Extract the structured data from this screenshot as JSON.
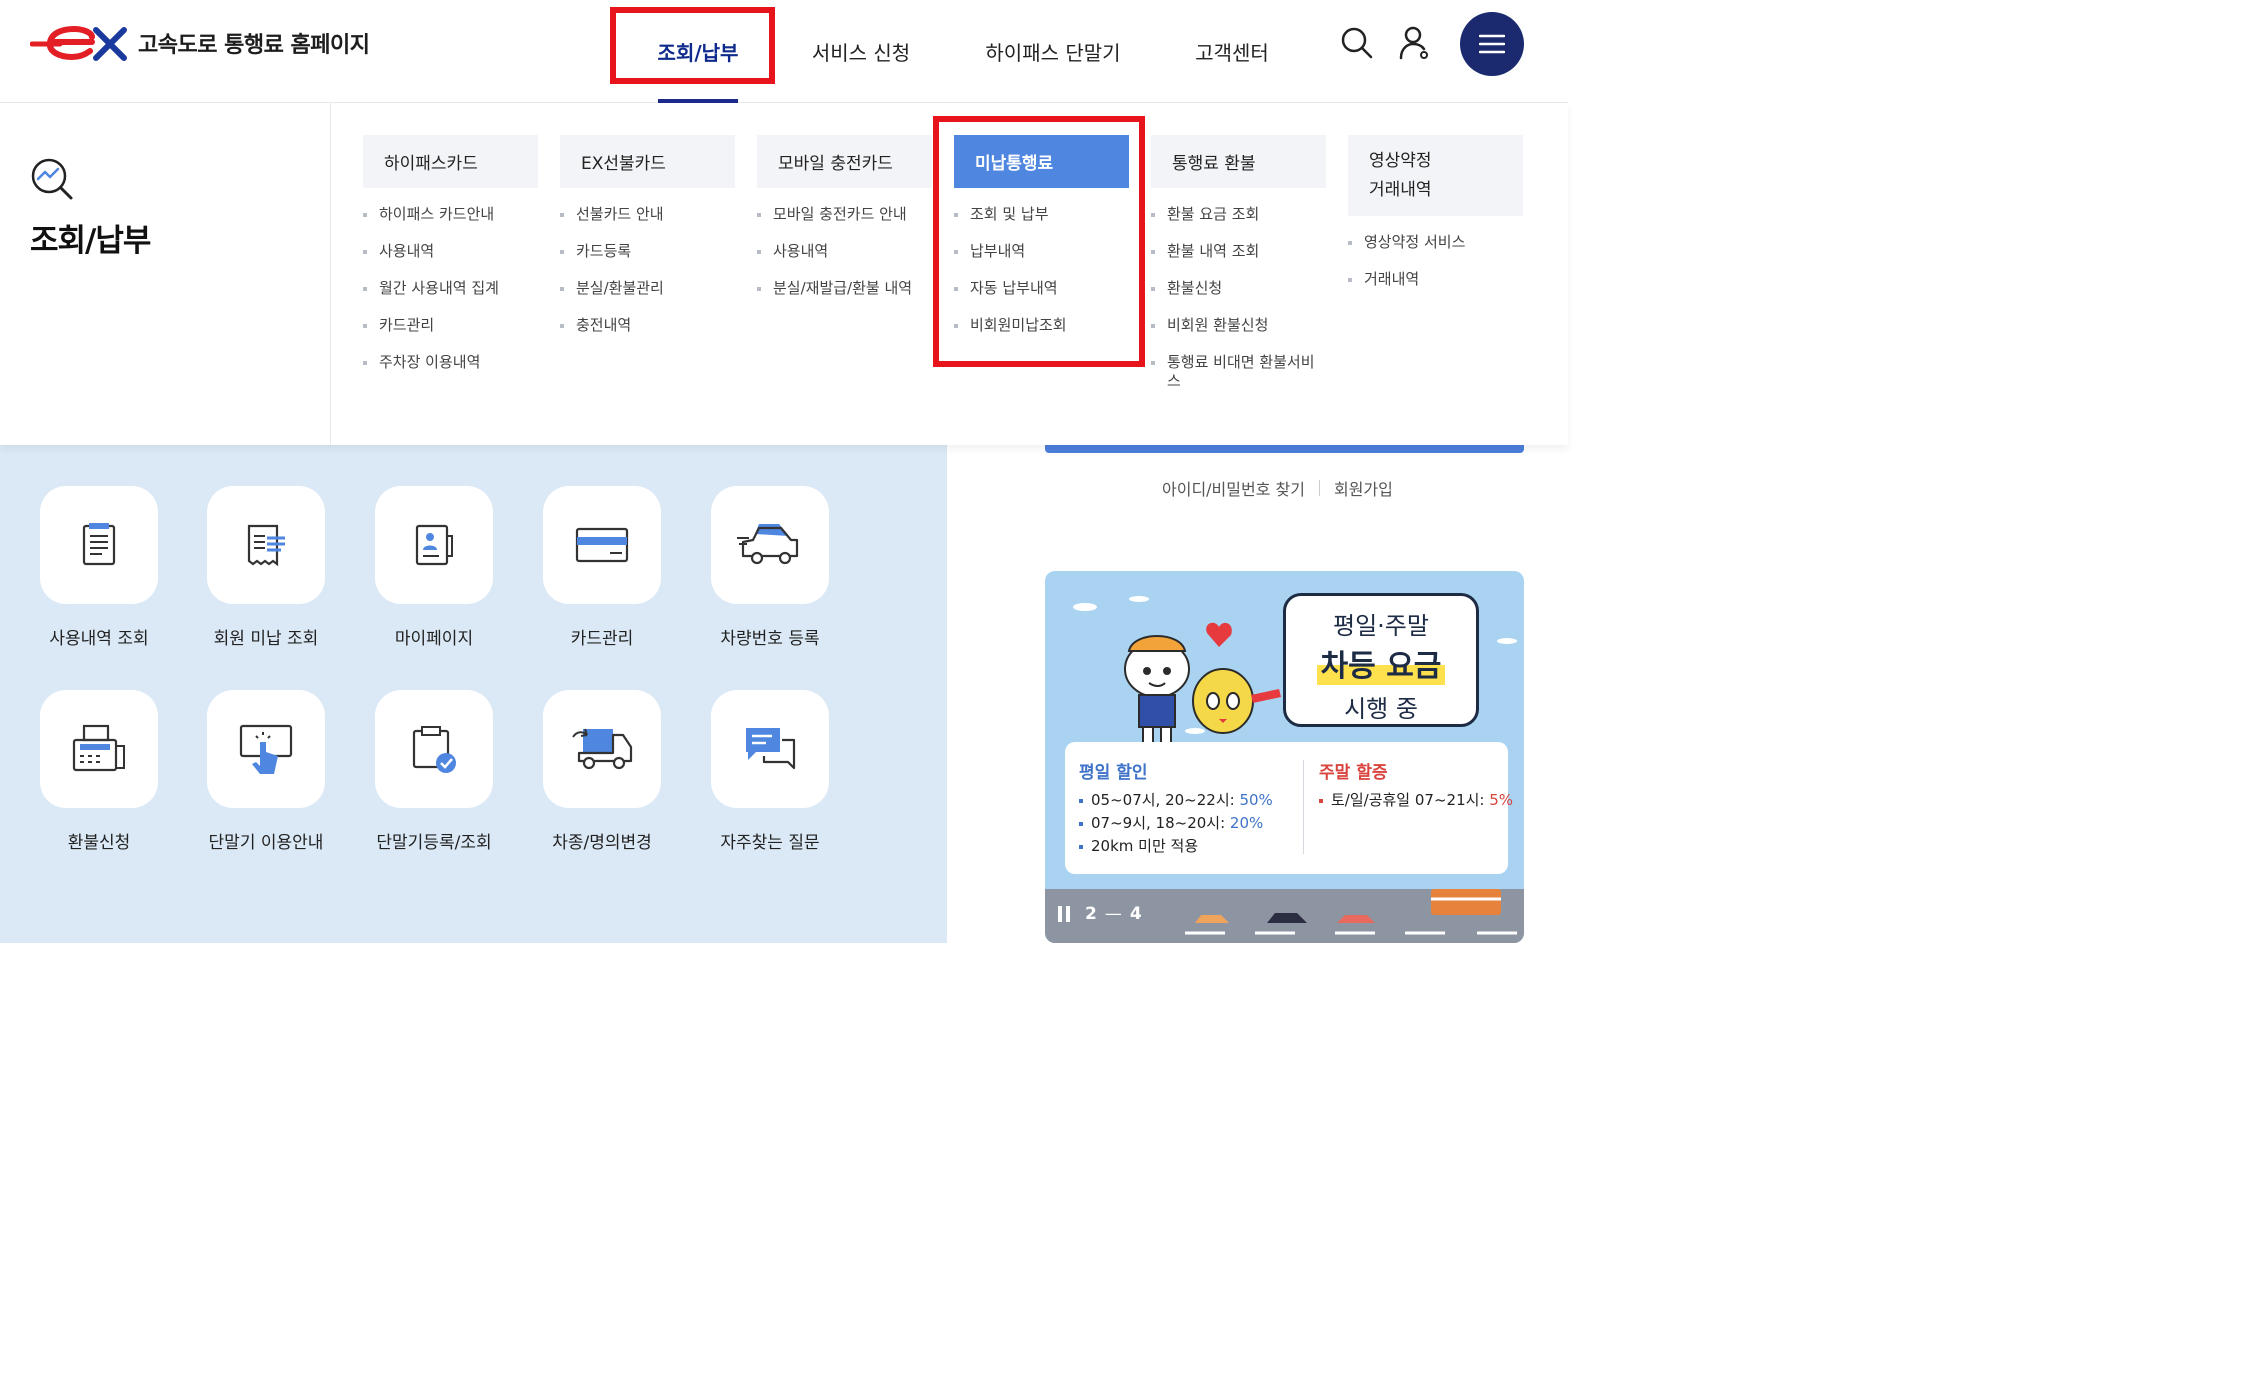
{
  "header": {
    "site_title": "고속도로 통행료 홈페이지",
    "nav": [
      "조회/납부",
      "서비스 신청",
      "하이패스 단말기",
      "고객센터"
    ]
  },
  "mega": {
    "title": "조회/납부",
    "columns": [
      {
        "head": "하이패스카드",
        "items": [
          "하이패스 카드안내",
          "사용내역",
          "월간 사용내역 집계",
          "카드관리",
          "주차장 이용내역"
        ]
      },
      {
        "head": "EX선불카드",
        "items": [
          "선불카드 안내",
          "카드등록",
          "분실/환불관리",
          "충전내역"
        ]
      },
      {
        "head": "모바일 충전카드",
        "items": [
          "모바일 충전카드 안내",
          "사용내역",
          "분실/재발급/환불 내역"
        ]
      },
      {
        "head": "미납통행료",
        "items": [
          "조회 및 납부",
          "납부내역",
          "자동 납부내역",
          "비회원미납조회"
        ]
      },
      {
        "head": "통행료 환불",
        "items": [
          "환불 요금 조회",
          "환불 내역 조회",
          "환불신청",
          "비회원 환불신청",
          "통행료 비대면 환불서비스"
        ]
      },
      {
        "head_line1": "영상약정",
        "head_line2": "거래내역",
        "items": [
          "영상약정 서비스",
          "거래내역"
        ]
      }
    ]
  },
  "quick_menu": [
    "사용내역 조회",
    "회원 미납 조회",
    "마이페이지",
    "카드관리",
    "차량번호 등록",
    "환불신청",
    "단말기 이용안내",
    "단말기등록/조회",
    "차종/명의변경",
    "자주찾는 질문"
  ],
  "login": {
    "find_label": "아이디/비밀번호 찾기",
    "join_label": "회원가입"
  },
  "banner": {
    "bubble_line1": "평일·주말",
    "bubble_line2": "차등 요금",
    "bubble_line3": "시행 중",
    "weekday_title": "평일 할인",
    "weekday_1_text": "05~07시, 20~22시: ",
    "weekday_1_value": "50%",
    "weekday_2_text": "07~9시, 18~20시: ",
    "weekday_2_value": "20%",
    "weekday_3_text": "20km 미만 적용",
    "weekend_title": "주말 할증",
    "weekend_1_text": "토/일/공휴일 07~21시: ",
    "weekend_1_value": "5%",
    "slide_current": "2",
    "slide_sep": "—",
    "slide_total": "4"
  },
  "colors": {
    "accent_blue": "#4e86e0",
    "navy": "#1b2a6e",
    "highlight_red": "#e8141b"
  }
}
